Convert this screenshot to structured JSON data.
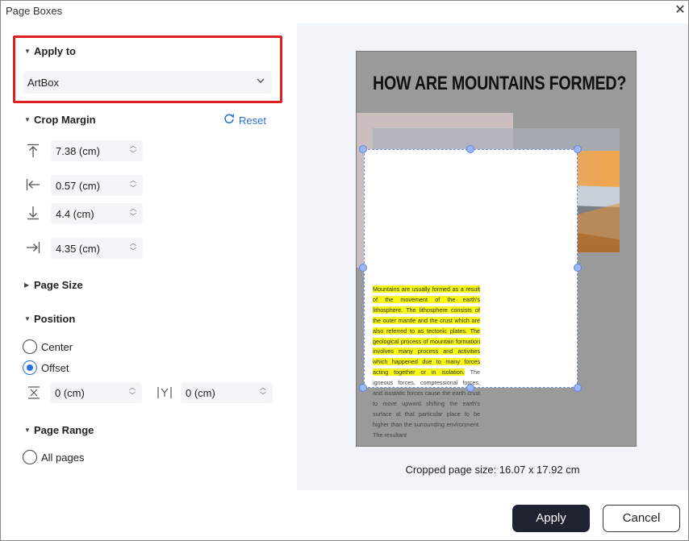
{
  "window": {
    "title": "Page Boxes"
  },
  "apply_to": {
    "label": "Apply to",
    "selected": "ArtBox"
  },
  "crop_margin": {
    "label": "Crop Margin",
    "reset_label": "Reset",
    "top": "7.38 (cm)",
    "left": "0.57 (cm)",
    "bottom": "4.4 (cm)",
    "right": "4.35 (cm)"
  },
  "page_size": {
    "label": "Page Size"
  },
  "position": {
    "label": "Position",
    "center_label": "Center",
    "offset_label": "Offset",
    "selected": "Offset",
    "x_value": "0 (cm)",
    "y_value": "0 (cm)"
  },
  "page_range": {
    "label": "Page Range",
    "all_pages_label": "All pages"
  },
  "preview": {
    "page_title": "HOW ARE MOUNTAINS FORMED?",
    "body_highlighted": "Mountains are usually formed as a result of the movement of the earth's lithosphere. The lithosphere consists of the outer mantle and the crust which are also referred to as tectonic plates. The geological process of mountain formation involves many process and activities which happened due to many forces acting together or in isolation.",
    "body_normal": " The igneous forces, compressional forces, and isostatic forces cause the earth crust to move upward shifting the earth's surface at that particular place to be higher than the surrounding environment. The resultant",
    "cropped_size": "Cropped page size: 16.07 x 17.92 cm"
  },
  "buttons": {
    "apply": "Apply",
    "cancel": "Cancel"
  },
  "colors": {
    "accent": "#2a6fdb",
    "highlight_frame": "#e02020",
    "primary_button": "#1f2230",
    "text_highlight": "#f5f51a"
  }
}
